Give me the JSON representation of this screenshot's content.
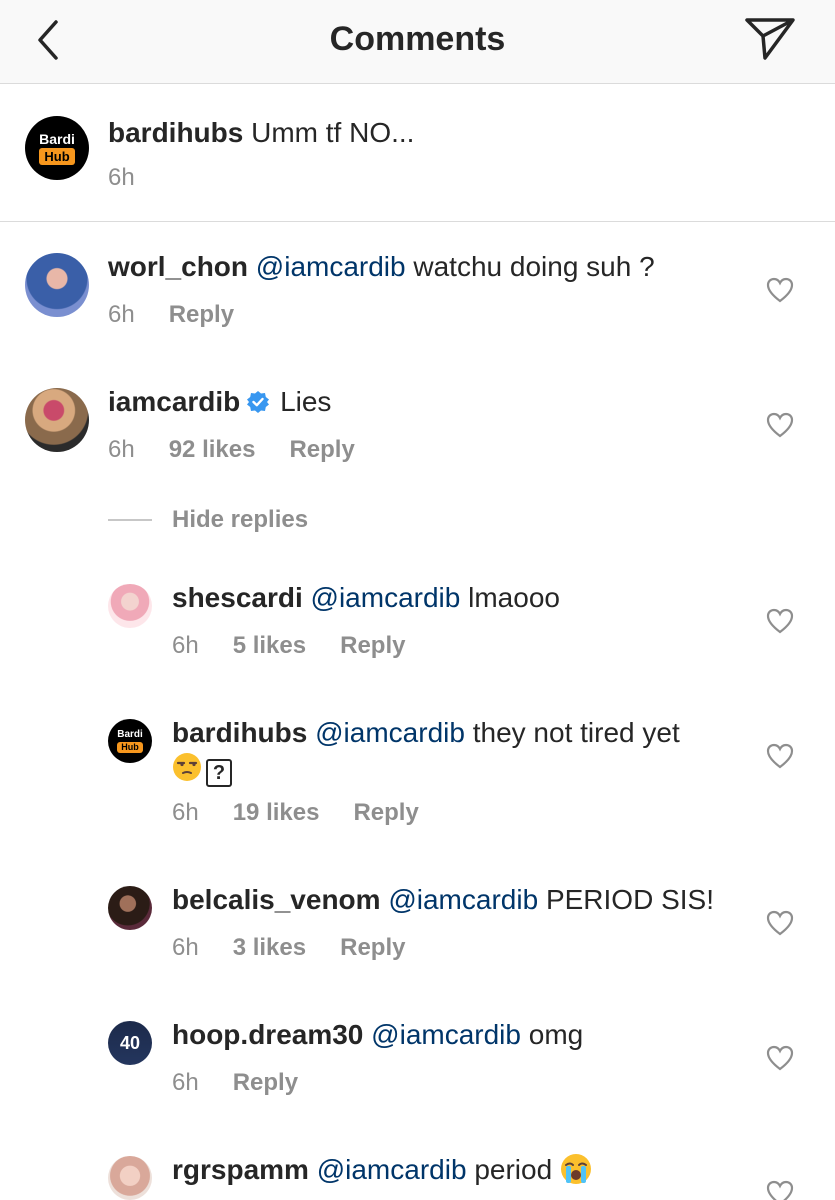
{
  "header": {
    "title": "Comments",
    "back_icon": "chevron-left-icon",
    "send_icon": "paper-plane-icon"
  },
  "caption": {
    "username": "bardihubs",
    "text": "Umm tf NO...",
    "time": "6h",
    "avatar": {
      "line1": "Bardi",
      "line2": "Hub"
    }
  },
  "hide_replies": "Hide replies",
  "comments": [
    {
      "username": "worl_chon",
      "mention": "@iamcardib",
      "text": "watchu doing suh ?",
      "time": "6h",
      "reply": "Reply"
    },
    {
      "username": "iamcardib",
      "text": "Lies",
      "time": "6h",
      "likes": "92 likes",
      "reply": "Reply"
    }
  ],
  "replies": [
    {
      "username": "shescardi",
      "mention": "@iamcardib",
      "text": "lmaooo",
      "time": "6h",
      "likes": "5 likes",
      "reply": "Reply"
    },
    {
      "username": "bardihubs",
      "mention": "@iamcardib",
      "text": "they not tired yet",
      "time": "6h",
      "likes": "19 likes",
      "reply": "Reply",
      "avatar": {
        "line1": "Bardi",
        "line2": "Hub"
      }
    },
    {
      "username": "belcalis_venom",
      "mention": "@iamcardib",
      "text": "PERIOD SIS!",
      "time": "6h",
      "likes": "3 likes",
      "reply": "Reply"
    },
    {
      "username": "hoop.dream30",
      "mention": "@iamcardib",
      "text": "omg",
      "time": "6h",
      "reply": "Reply",
      "jersey": "40"
    },
    {
      "username": "rgrspamm",
      "mention": "@iamcardib",
      "text": "period"
    }
  ],
  "colors": {
    "mention": "#003569",
    "meta": "#8e8e8e",
    "text": "#262626",
    "divider": "#dbdbdb",
    "verified": "#3897f0",
    "logo_accent": "#f7971d"
  }
}
